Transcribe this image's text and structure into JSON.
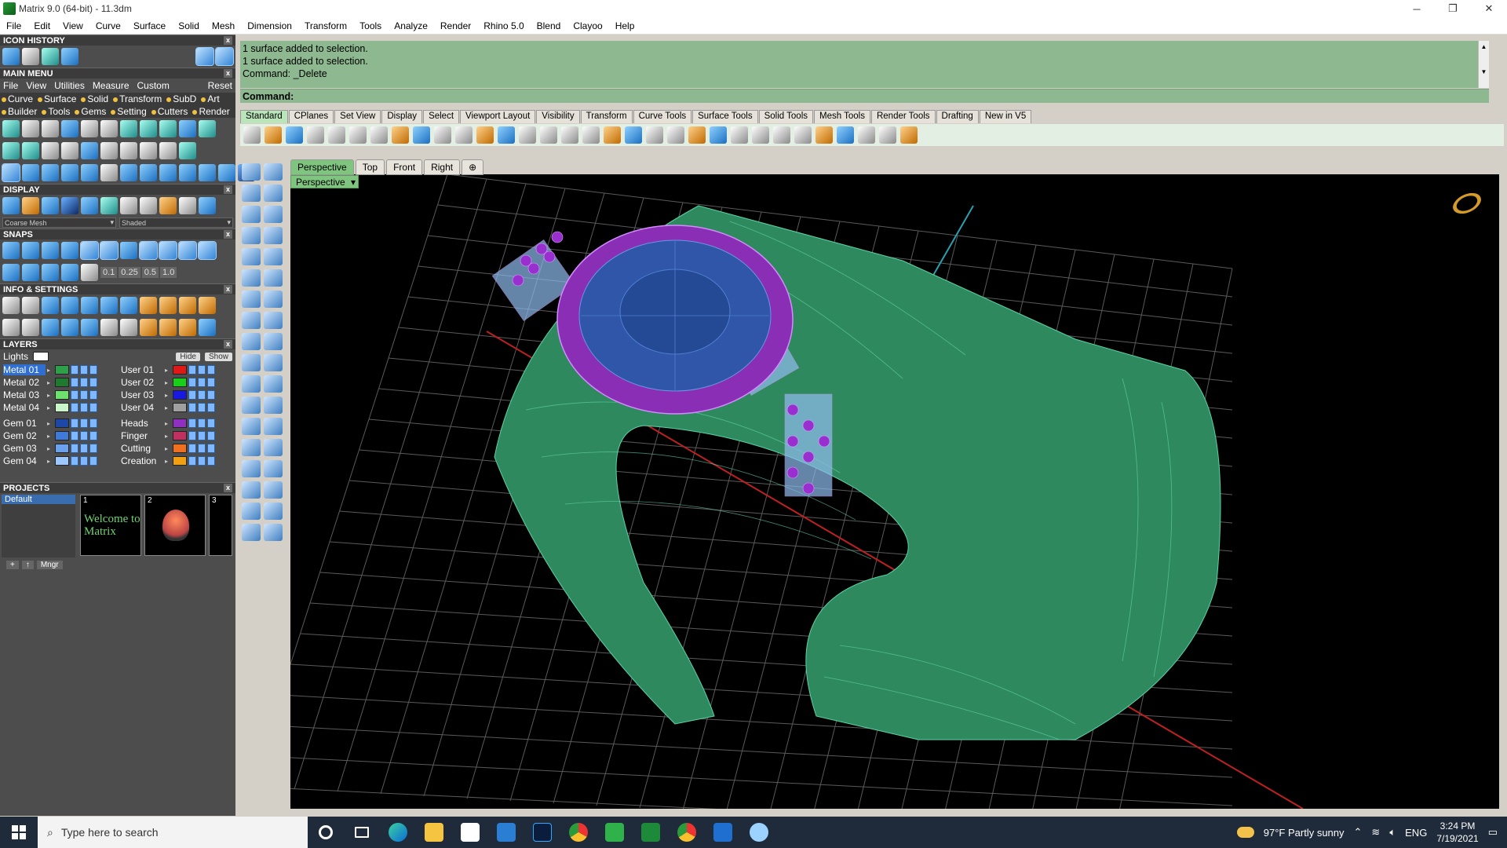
{
  "window": {
    "title": "Matrix 9.0 (64-bit) - 11.3dm",
    "min": "─",
    "max": "❐",
    "close": "✕"
  },
  "menubar": [
    "File",
    "Edit",
    "View",
    "Curve",
    "Surface",
    "Solid",
    "Mesh",
    "Dimension",
    "Transform",
    "Tools",
    "Analyze",
    "Render",
    "Rhino 5.0",
    "Blend",
    "Clayoo",
    "Help"
  ],
  "panels": {
    "icon_history": "ICON HISTORY",
    "main_menu": "MAIN MENU",
    "display": "DISPLAY",
    "snaps": "SNAPS",
    "info_settings": "INFO & SETTINGS",
    "layers": "LAYERS",
    "projects": "PROJECTS"
  },
  "main_menu_bar": [
    "File",
    "View",
    "Utilities",
    "Measure",
    "Custom"
  ],
  "main_menu_reset": "Reset",
  "main_menu_row1": [
    "Curve",
    "Surface",
    "Solid",
    "Transform",
    "SubD",
    "Art"
  ],
  "main_menu_row2": [
    "Builder",
    "Tools",
    "Gems",
    "Setting",
    "Cutters",
    "Render"
  ],
  "display_dropdowns": [
    "Coarse Mesh",
    "Shaded"
  ],
  "snap_values": [
    "0.1",
    "0.25",
    "0.5",
    "1.0"
  ],
  "layers": {
    "lights": "Lights",
    "hide": "Hide",
    "show": "Show",
    "left": [
      {
        "name": "Metal 01",
        "color": "#2fa04a",
        "active": true
      },
      {
        "name": "Metal 02",
        "color": "#1f7a30"
      },
      {
        "name": "Metal 03",
        "color": "#6ee06e"
      },
      {
        "name": "Metal 04",
        "color": "#c9f5c9"
      },
      {
        "name": "Gem 01",
        "color": "#1d48a8"
      },
      {
        "name": "Gem 02",
        "color": "#3f7ad8"
      },
      {
        "name": "Gem 03",
        "color": "#6aa2f0"
      },
      {
        "name": "Gem 04",
        "color": "#9cc8ff"
      }
    ],
    "right": [
      {
        "name": "User 01",
        "color": "#e01818"
      },
      {
        "name": "User 02",
        "color": "#18d018"
      },
      {
        "name": "User 03",
        "color": "#1818e0"
      },
      {
        "name": "User 04",
        "color": "#a0a0a0"
      },
      {
        "name": "Heads",
        "color": "#9030c0"
      },
      {
        "name": "Finger",
        "color": "#c03060"
      },
      {
        "name": "Cutting",
        "color": "#f07020"
      },
      {
        "name": "Creation",
        "color": "#f0a010"
      }
    ]
  },
  "projects": {
    "default": "Default",
    "thumb1_num": "1",
    "thumb1_text": "Welcome to Matrix",
    "thumb2_num": "2",
    "thumb3_num": "3",
    "mngr": "Mngr"
  },
  "command_history": [
    "1 surface added to selection.",
    "1 surface added to selection.",
    "Command: _Delete"
  ],
  "command_prompt": "Command:",
  "toolbar_tabs": [
    "Standard",
    "CPlanes",
    "Set View",
    "Display",
    "Select",
    "Viewport Layout",
    "Visibility",
    "Transform",
    "Curve Tools",
    "Surface Tools",
    "Solid Tools",
    "Mesh Tools",
    "Render Tools",
    "Drafting",
    "New in V5"
  ],
  "viewport_tabs": [
    "Perspective",
    "Top",
    "Front",
    "Right"
  ],
  "viewport_add": "⊕",
  "viewport_label": "Perspective",
  "taskbar": {
    "search_placeholder": "Type here to search",
    "weather": "97°F  Partly sunny",
    "lang": "ENG",
    "time": "3:24 PM",
    "date": "7/19/2021"
  },
  "colors": {
    "command_bg": "#8db890",
    "active_tab": "#7fc47f",
    "ring_green": "#2e8a5e",
    "bezel_purple": "#8a2fb5",
    "gem_blue": "#2f56a8"
  }
}
